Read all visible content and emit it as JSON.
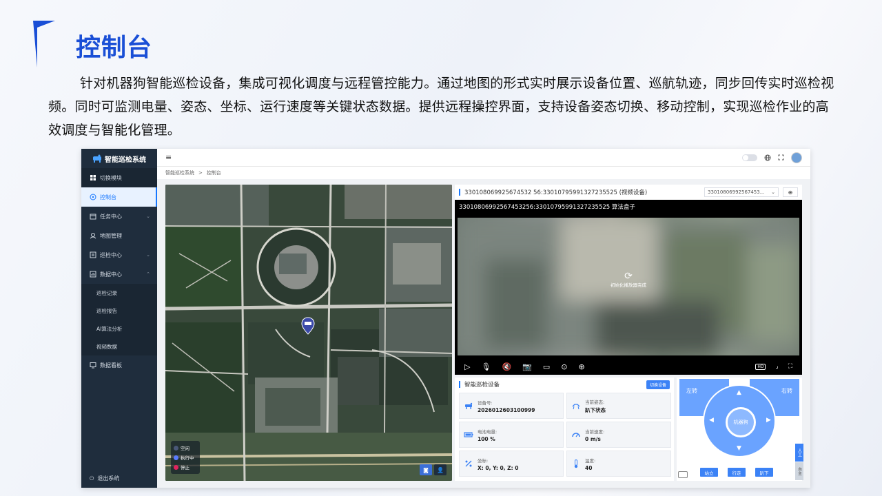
{
  "slide": {
    "title": "控制台",
    "description": "针对机器狗智能巡检设备，集成可视化调度与远程管控能力。通过地图的形式实时展示设备位置、巡航轨迹，同步回传实时巡检视频。同时可监测电量、姿态、坐标、运行速度等关键状态数据。提供远程操控界面，支持设备姿态切换、移动控制，实现巡检作业的高效调度与智能化管理。"
  },
  "app": {
    "brand": "智能巡检系统",
    "sidebar": {
      "items": [
        {
          "label": "切换模块",
          "icon": "grid-icon"
        },
        {
          "label": "控制台",
          "icon": "dashboard-icon"
        },
        {
          "label": "任务中心",
          "icon": "calendar-icon"
        },
        {
          "label": "地图管理",
          "icon": "map-pin-icon"
        },
        {
          "label": "巡检中心",
          "icon": "list-icon"
        },
        {
          "label": "数据中心",
          "icon": "chart-icon"
        }
      ],
      "sub_items": [
        "巡检记录",
        "巡检报告",
        "AI算法分析",
        "视频数据"
      ],
      "last_item": {
        "label": "数据看板",
        "icon": "monitor-icon"
      },
      "logout": "退出系统"
    },
    "topbar": {
      "menu_icon": "≡"
    },
    "breadcrumb": {
      "root": "智能巡检系统",
      "separator": ">",
      "current": "控制台"
    },
    "map": {
      "legend": [
        {
          "label": "空闲",
          "color": "#4a5878"
        },
        {
          "label": "执行中",
          "color": "#5a7cff"
        },
        {
          "label": "停止",
          "color": "#e0245e"
        }
      ]
    },
    "video": {
      "title": "330108069925674532 56:33010795991327235525 (视频设备)",
      "select_value": "33010806992567453...",
      "caption": "33010806992567453256:33010795991327235525    算法盒子",
      "loading_text": "初始化播放器完成",
      "hd_label": "HD"
    },
    "device": {
      "title": "智能巡检设备",
      "switch_label": "切换设备",
      "cards": [
        {
          "label": "设备号:",
          "value": "2026012603100999",
          "icon": "robot-icon"
        },
        {
          "label": "当前姿态:",
          "value": "趴下状态",
          "icon": "posture-icon"
        },
        {
          "label": "电池电量:",
          "value": "100 %",
          "icon": "battery-icon"
        },
        {
          "label": "当前速度:",
          "value": "0 m/s",
          "icon": "speedometer-icon"
        },
        {
          "label": "坐标:",
          "value": "X: 0, Y: 0, Z: 0",
          "icon": "coordinate-icon"
        },
        {
          "label": "温度:",
          "value": "40",
          "icon": "thermometer-icon"
        }
      ]
    },
    "control": {
      "turn_left": "左转",
      "turn_right": "右转",
      "center": "机器狗",
      "buttons": [
        "站立",
        "行走",
        "趴下"
      ],
      "side_tabs": [
        "人工",
        "自主"
      ]
    }
  }
}
